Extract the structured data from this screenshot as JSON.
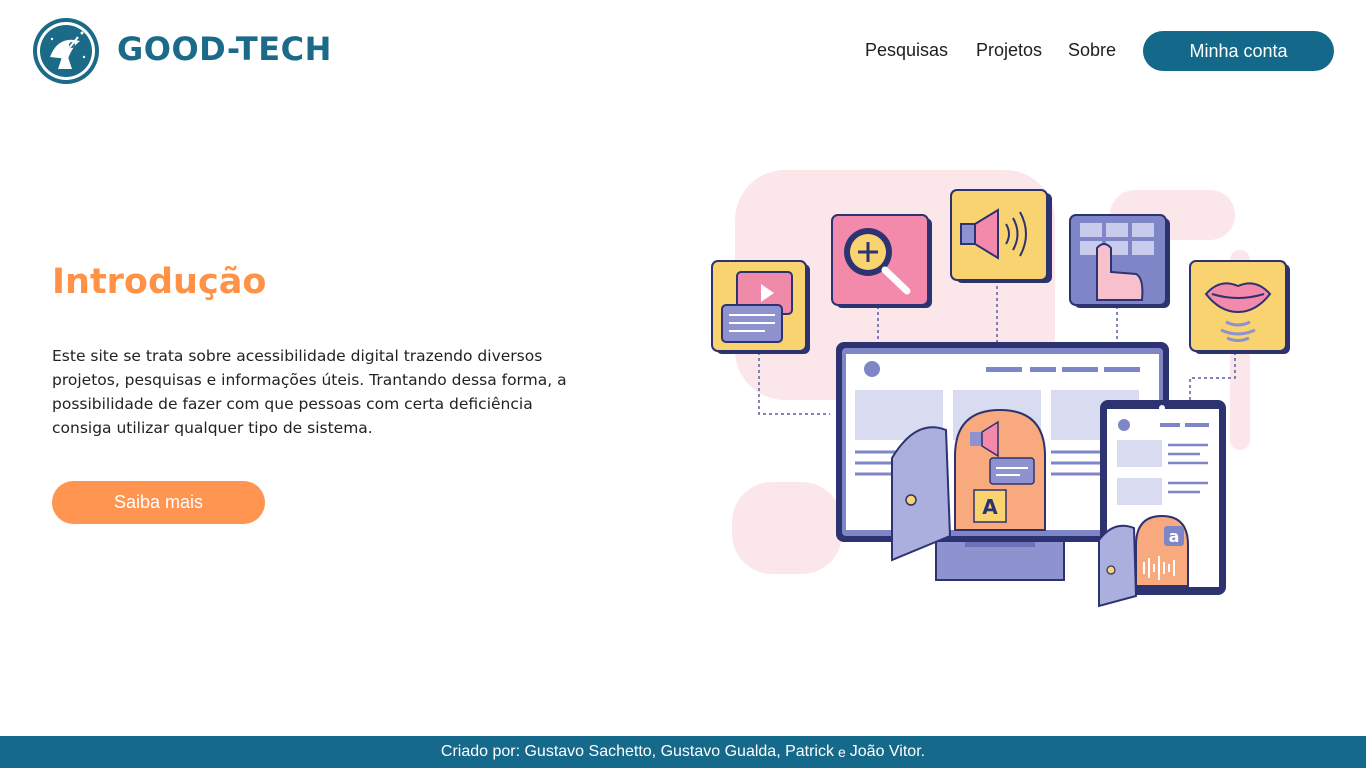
{
  "header": {
    "brand": "GOOD-TECH",
    "logo_icon": "satellite-dish-icon",
    "nav": [
      "Pesquisas",
      "Projetos",
      "Sobre"
    ],
    "account_button": "Minha conta",
    "colors": {
      "brand": "#1a6a88",
      "button": "#14688a"
    }
  },
  "hero": {
    "title": "Introdução",
    "text": "Este site se trata sobre acessibilidade digital trazendo diversos projetos, pesquisas e informações úteis. Trantando dessa forma, a possibilidade de fazer com que pessoas com certa deficiência consiga utilizar qualquer tipo de sistema.",
    "cta": "Saiba mais",
    "colors": {
      "accent": "#ff9246"
    }
  },
  "illustration": {
    "icons": [
      "video-chat-icon",
      "zoom-in-icon",
      "speaker-icon",
      "touch-keyboard-icon",
      "lips-speech-icon",
      "monitor-icon",
      "tablet-icon"
    ]
  },
  "footer": {
    "prefix": "Criado por: Gustavo Sachetto, Gustavo Gualda, Patrick",
    "conjunction": "e",
    "suffix": "João Vitor.",
    "color": "#15698a"
  }
}
